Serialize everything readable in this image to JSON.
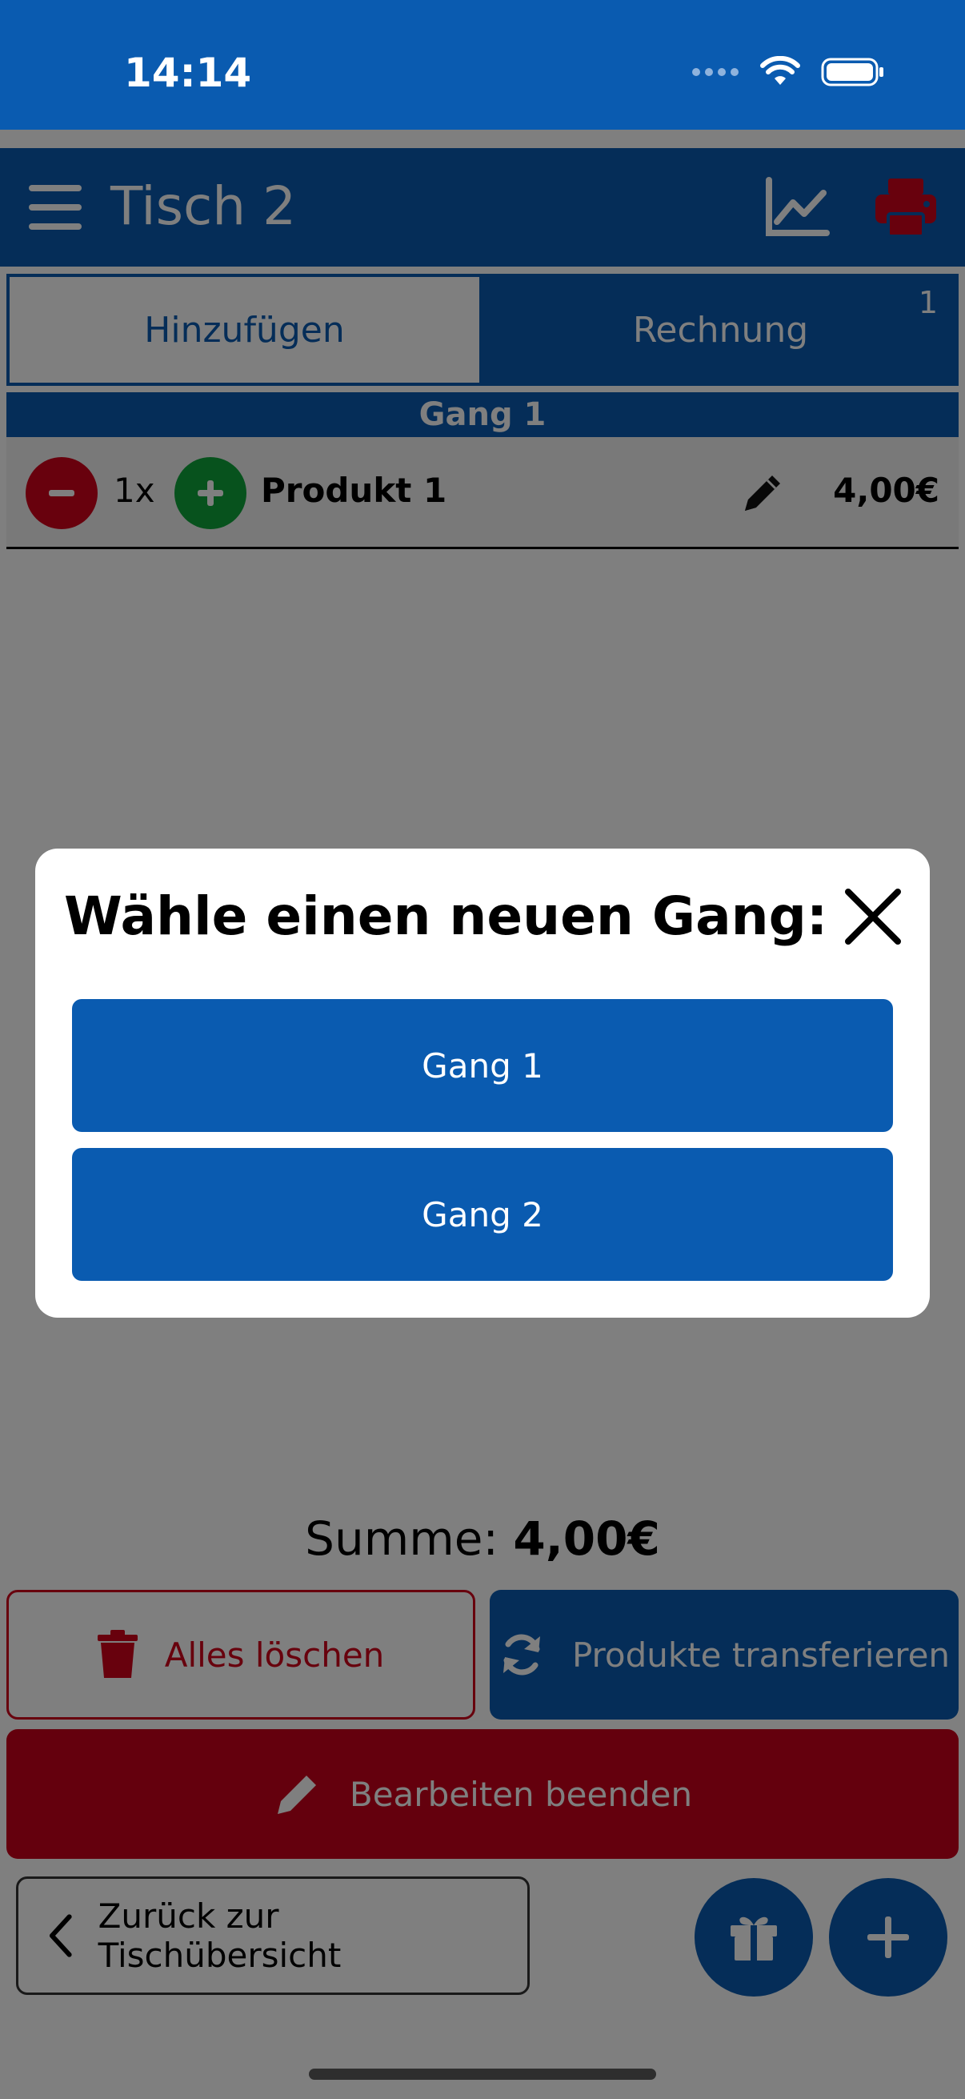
{
  "status_bar": {
    "time": "14:14"
  },
  "header": {
    "title": "Tisch 2"
  },
  "tabs": [
    {
      "label": "Hinzufügen",
      "active": true
    },
    {
      "label": "Rechnung",
      "badge": "1"
    }
  ],
  "order": {
    "course": "Gang 1",
    "items": [
      {
        "quantity": "1x",
        "name": "Produkt 1",
        "price": "4,00€"
      }
    ]
  },
  "summary": {
    "label": "Summe:",
    "total": "4,00€"
  },
  "actions": {
    "delete_all": "Alles löschen",
    "transfer": "Produkte transferieren",
    "finish_edit": "Bearbeiten beenden",
    "back": "Zurück zur Tischübersicht"
  },
  "modal": {
    "title": "Wähle einen neuen Gang:",
    "options": [
      "Gang 1",
      "Gang 2"
    ]
  },
  "colors": {
    "primary": "#0a5bb0",
    "danger": "#d0021b",
    "success": "#0ea53a"
  },
  "icons": [
    "menu-icon",
    "chart-icon",
    "printer-icon",
    "minus-icon",
    "plus-icon",
    "pencil-icon",
    "trash-icon",
    "refresh-icon",
    "chevron-left-icon",
    "gift-icon",
    "close-icon"
  ]
}
